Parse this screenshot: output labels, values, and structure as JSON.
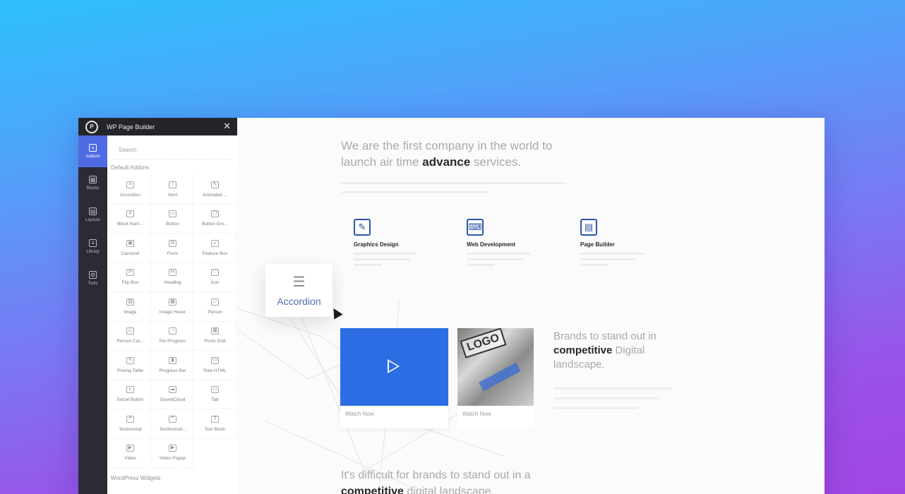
{
  "builder": {
    "title": "WP Page Builder",
    "close_glyph": "✕",
    "rail": [
      {
        "label": "Addons",
        "icon": "plus-icon",
        "glyph": "+",
        "active": true
      },
      {
        "label": "Blocks",
        "icon": "blocks-icon",
        "glyph": "▦",
        "active": false
      },
      {
        "label": "Layouts",
        "icon": "layouts-icon",
        "glyph": "▤",
        "active": false
      },
      {
        "label": "Library",
        "icon": "library-icon",
        "glyph": "≡",
        "active": false
      },
      {
        "label": "Tools",
        "icon": "tools-icon",
        "glyph": "⚙",
        "active": false
      }
    ],
    "search_placeholder": "Search",
    "section_title": "Default Addons",
    "addons": [
      {
        "label": "Accordion",
        "icon": "accordion-icon",
        "glyph": "≡"
      },
      {
        "label": "Alert",
        "icon": "alert-icon",
        "glyph": "!"
      },
      {
        "label": "Animated ...",
        "icon": "animated-icon",
        "glyph": "✎"
      },
      {
        "label": "Block Num...",
        "icon": "block-number-icon",
        "glyph": "#"
      },
      {
        "label": "Button",
        "icon": "button-icon",
        "glyph": "▭"
      },
      {
        "label": "Button Gro...",
        "icon": "button-group-icon",
        "glyph": "❐"
      },
      {
        "label": "Carousel",
        "icon": "carousel-icon",
        "glyph": "▣"
      },
      {
        "label": "Form",
        "icon": "form-icon",
        "glyph": "✉"
      },
      {
        "label": "Feature Box",
        "icon": "feature-box-icon",
        "glyph": "➶"
      },
      {
        "label": "Flip Box",
        "icon": "flip-box-icon",
        "glyph": "⟳"
      },
      {
        "label": "Heading",
        "icon": "heading-icon",
        "glyph": "H"
      },
      {
        "label": "Icon",
        "icon": "icon-icon",
        "glyph": "♡"
      },
      {
        "label": "Image",
        "icon": "image-icon",
        "glyph": "▨"
      },
      {
        "label": "Image Hover",
        "icon": "image-hover-icon",
        "glyph": "▩"
      },
      {
        "label": "Person",
        "icon": "person-icon",
        "glyph": "☺"
      },
      {
        "label": "Person Car...",
        "icon": "person-carousel-icon",
        "glyph": "▭"
      },
      {
        "label": "Pie Progress",
        "icon": "pie-progress-icon",
        "glyph": "◔"
      },
      {
        "label": "Posts Grid",
        "icon": "posts-grid-icon",
        "glyph": "▦"
      },
      {
        "label": "Pricing Table",
        "icon": "pricing-table-icon",
        "glyph": "✎"
      },
      {
        "label": "Progress Bar",
        "icon": "progress-bar-icon",
        "glyph": "▮"
      },
      {
        "label": "Raw HTML",
        "icon": "raw-html-icon",
        "glyph": "<>"
      },
      {
        "label": "Social Button",
        "icon": "social-button-icon",
        "glyph": "◐"
      },
      {
        "label": "SoundCloud",
        "icon": "soundcloud-icon",
        "glyph": "☁"
      },
      {
        "label": "Tab",
        "icon": "tab-icon",
        "glyph": "▭"
      },
      {
        "label": "Testimonial",
        "icon": "testimonial-icon",
        "glyph": "❝"
      },
      {
        "label": "Testimonial...",
        "icon": "testimonial-carousel-icon",
        "glyph": "❞"
      },
      {
        "label": "Text Block",
        "icon": "text-block-icon",
        "glyph": "T"
      },
      {
        "label": "Video",
        "icon": "video-icon",
        "glyph": "▶"
      },
      {
        "label": "Video Popup",
        "icon": "video-popup-icon",
        "glyph": "▶"
      }
    ],
    "wp_widgets_title": "WordPress Widgets"
  },
  "page": {
    "hero_line1": "We are the first company in the world to",
    "hero_line2_pre": "launch air time ",
    "hero_line2_bold": "advance",
    "hero_line2_post": " services.",
    "services": [
      {
        "title": "Graphics Design",
        "icon": "graphics-design-icon",
        "glyph": "✎"
      },
      {
        "title": "Web Development",
        "icon": "web-development-icon",
        "glyph": "⌨"
      },
      {
        "title": "Page Builder",
        "icon": "page-builder-icon",
        "glyph": "▤"
      }
    ],
    "drag_label": "Accordion",
    "drag_icon": "accordion-icon",
    "drag_glyph": "☰",
    "video_card_label": "Watch Now",
    "photo_card_label": "Watch Now",
    "photo_logo_text": "LOGO",
    "brands_line1": "Brands to stand out in",
    "brands_bold": "competitive",
    "brands_line2_post": " Digital",
    "brands_line3": "landscape.",
    "bottom_line1": "It's difficult for brands to stand out in a",
    "bottom_bold": "competitive",
    "bottom_line2_post": " digital landscape."
  }
}
